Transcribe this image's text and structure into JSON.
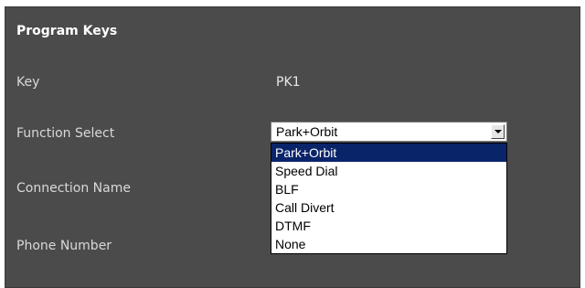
{
  "panel": {
    "title": "Program Keys"
  },
  "fields": {
    "key_label": "Key",
    "key_value": "PK1",
    "function_label": "Function Select",
    "connection_label": "Connection Name",
    "phone_label": "Phone Number"
  },
  "function_select": {
    "value": "Park+Orbit",
    "options": [
      "Park+Orbit",
      "Speed Dial",
      "BLF",
      "Call Divert",
      "DTMF",
      "None"
    ],
    "highlighted_index": 0
  },
  "colors": {
    "panel_bg": "#4b4b4b",
    "highlight": "#0a246a"
  }
}
